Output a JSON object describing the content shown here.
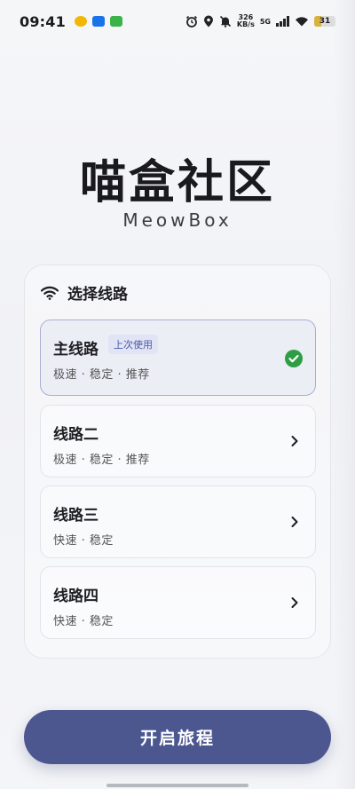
{
  "status_bar": {
    "time": "09:41",
    "net_speed": "326\nKB/s",
    "network": "5G",
    "battery": "31",
    "icons": [
      "notif-app-1-icon",
      "notif-app-2-icon",
      "notif-app-3-icon",
      "alarm-icon",
      "location-icon",
      "mute-icon",
      "signal-icon",
      "wifi-icon",
      "battery-icon"
    ]
  },
  "app": {
    "title": "喵盒社区",
    "subtitle": "MeowBox"
  },
  "route_panel": {
    "heading": "选择线路",
    "heading_icon": "wifi-icon",
    "routes": [
      {
        "name": "主线路",
        "tag": "上次使用",
        "desc": "极速 · 稳定 · 推荐",
        "selected": true,
        "indicator_icon": "check-circle-icon"
      },
      {
        "name": "线路二",
        "desc": "极速 · 稳定 · 推荐",
        "selected": false,
        "indicator_icon": "chevron-right-icon"
      },
      {
        "name": "线路三",
        "desc": "快速 · 稳定",
        "selected": false,
        "indicator_icon": "chevron-right-icon"
      },
      {
        "name": "线路四",
        "desc": "快速 · 稳定",
        "selected": false,
        "indicator_icon": "chevron-right-icon"
      }
    ]
  },
  "primary_action": {
    "label": "开启旅程"
  },
  "colors": {
    "accent": "#4c5790",
    "selected_border": "#a9aed0",
    "check_green": "#2e9e44"
  }
}
